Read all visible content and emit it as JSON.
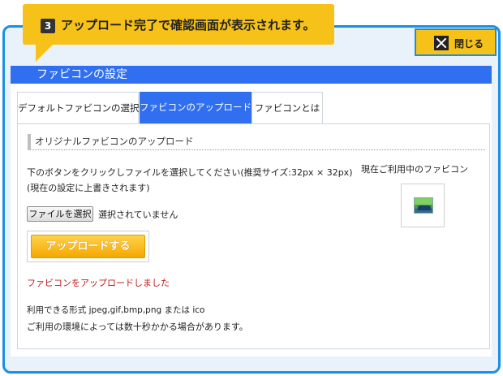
{
  "callout": {
    "step_number": "3",
    "text": "アップロード完了で確認画面が表示されます。"
  },
  "close_button": {
    "label": "閉じる"
  },
  "dialog": {
    "title": "ファビコンの設定"
  },
  "tabs": [
    {
      "label": "デフォルトファビコンの選択",
      "active": false
    },
    {
      "label": "ファビコンのアップロード",
      "active": true
    },
    {
      "label": "ファビコンとは",
      "active": false
    }
  ],
  "section": {
    "title": "オリジナルファビコンのアップロード",
    "instruction_line1": "下のボタンをクリックしファイルを選択してください(推奨サイズ:32px × 32px)",
    "instruction_line2": "(現在の設定に上書きされます)",
    "current_favicon_label": "現在ご利用中のファビコン",
    "file_button_label": "ファイルを選択",
    "file_status": "選択されていません",
    "upload_button_label": "アップロードする",
    "success_message": "ファビコンをアップロードしました",
    "formats_text": "利用できる形式 jpeg,gif,bmp,png または ico",
    "note_text": "ご利用の環境によっては数十秒かかる場合があります。"
  },
  "colors": {
    "accent_blue": "#2f6ff0",
    "frame_blue": "#1a8fe3",
    "callout_yellow": "#f6c21a",
    "success_red": "#c01818"
  }
}
